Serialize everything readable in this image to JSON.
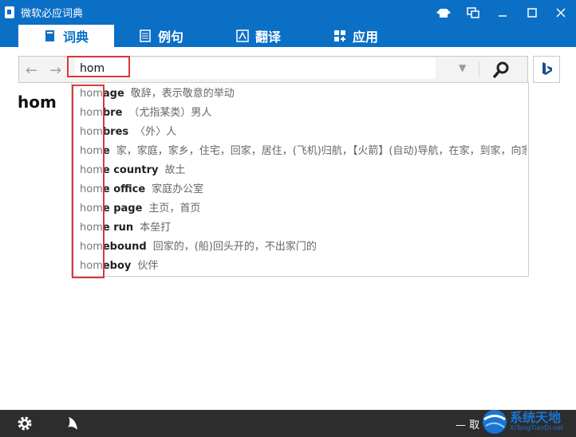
{
  "window": {
    "title": "微软必应词典"
  },
  "tabs": [
    {
      "label": "词典",
      "active": true
    },
    {
      "label": "例句",
      "active": false
    },
    {
      "label": "翻译",
      "active": false
    },
    {
      "label": "应用",
      "active": false
    }
  ],
  "search": {
    "value": "hom",
    "placeholder": ""
  },
  "headword": "hom",
  "suggestions": [
    {
      "prefix": "hom",
      "rest": "age",
      "definition": "敬辞，表示敬意的举动"
    },
    {
      "prefix": "hom",
      "rest": "bre",
      "definition": "（尤指某类）男人"
    },
    {
      "prefix": "hom",
      "rest": "bres",
      "definition": "〈外〉人"
    },
    {
      "prefix": "hom",
      "rest": "e",
      "definition": "家，家庭，家乡，住宅，回家，居住，(飞机)归航，【火箭】(自动)导航，在家，到家，向家"
    },
    {
      "prefix": "hom",
      "rest": "e country",
      "definition": "故土"
    },
    {
      "prefix": "hom",
      "rest": "e office",
      "definition": "家庭办公室"
    },
    {
      "prefix": "hom",
      "rest": "e page",
      "definition": "主页，首页"
    },
    {
      "prefix": "hom",
      "rest": "e run",
      "definition": "本垒打"
    },
    {
      "prefix": "hom",
      "rest": "ebound",
      "definition": "回家的，(船)回头开的，不出家门的"
    },
    {
      "prefix": "hom",
      "rest": "eboy",
      "definition": "伙伴"
    }
  ],
  "bottom": {
    "text": "取"
  },
  "watermark": {
    "title": "系统天地",
    "subtitle": "XiTongTianDi.net"
  },
  "colors": {
    "accent": "#0b6fc6",
    "highlight": "#d9383a",
    "bottombar": "#2d2d2d"
  }
}
